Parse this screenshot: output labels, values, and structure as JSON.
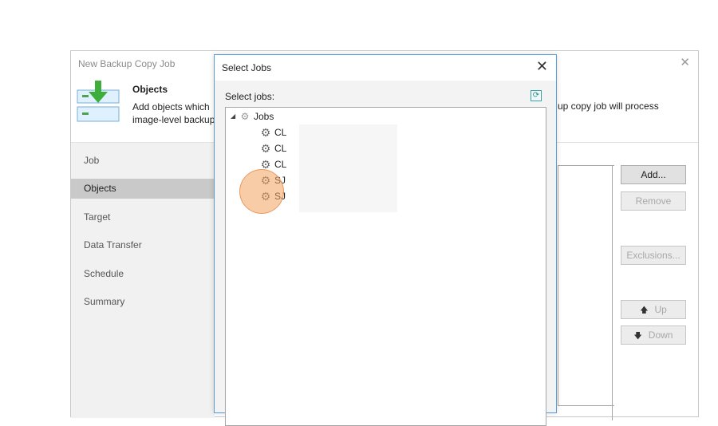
{
  "wizard": {
    "title": "New Backup Copy Job",
    "close_icon": "close-icon",
    "header": {
      "title": "Objects",
      "description_line1": "Add objects which",
      "description_line1_tail": "up copy job will process",
      "description_line2": "image-level backup"
    },
    "nav": {
      "items": [
        {
          "label": "Job"
        },
        {
          "label": "Objects"
        },
        {
          "label": "Target"
        },
        {
          "label": "Data Transfer"
        },
        {
          "label": "Schedule"
        },
        {
          "label": "Summary"
        }
      ],
      "active": "Objects"
    },
    "buttons": {
      "add": "Add...",
      "remove": "Remove",
      "exclusions": "Exclusions...",
      "up": "Up",
      "down": "Down"
    }
  },
  "dialog": {
    "title": "Select Jobs",
    "select_label": "Select jobs:",
    "tree": {
      "root": {
        "label": "Jobs",
        "icon": "gear-icon",
        "expanded": true
      },
      "children": [
        {
          "label": "CL",
          "icon": "gear-icon"
        },
        {
          "label": "CL",
          "icon": "gear-icon"
        },
        {
          "label": "CL",
          "icon": "gear-icon"
        },
        {
          "label": "SJ",
          "icon": "gear-icon"
        },
        {
          "label": "SJ",
          "icon": "gear-icon"
        }
      ]
    }
  },
  "colors": {
    "dialog_border": "#5b9bd5",
    "nav_active": "#c9c9c9",
    "click_indicator": "#f4a261",
    "refresh_accent": "#3aa0a5"
  }
}
